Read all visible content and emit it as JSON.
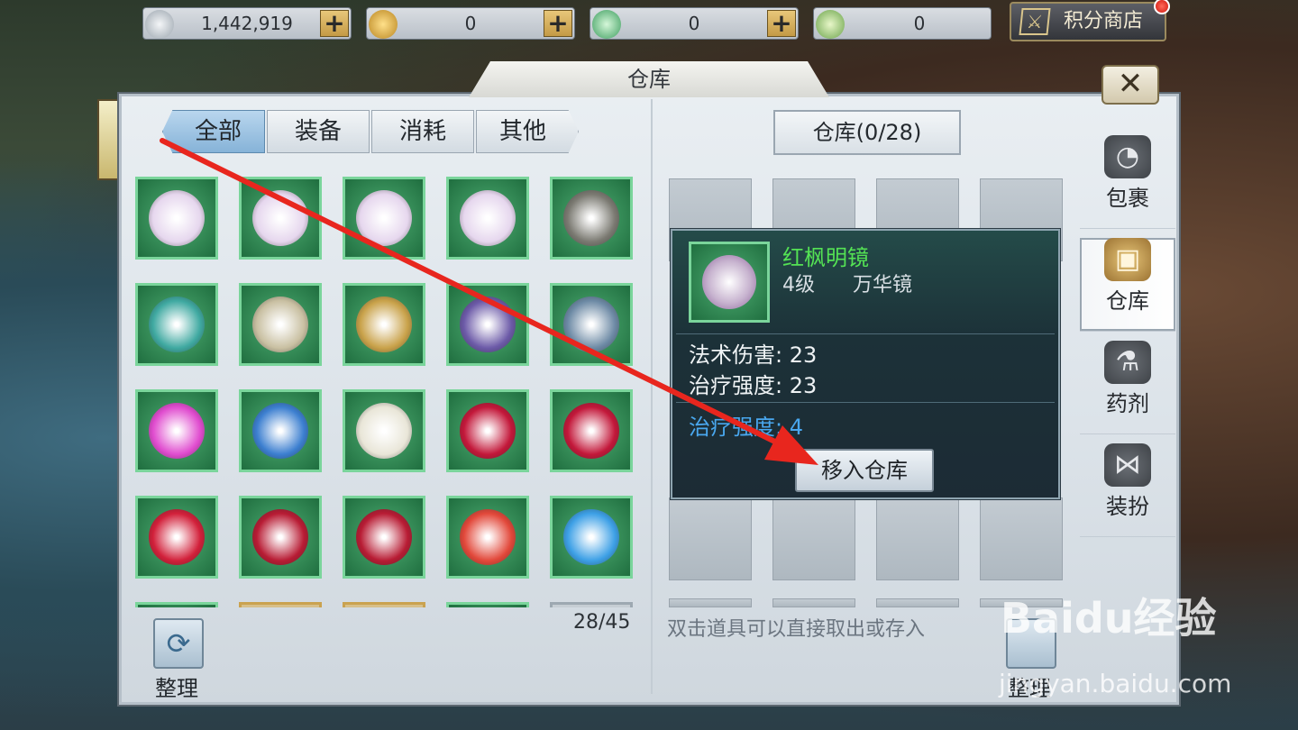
{
  "currencies": [
    {
      "name": "silver-coin-icon",
      "value": "1,442,919",
      "color": "#cfd6dd"
    },
    {
      "name": "gold-coin-icon",
      "value": "0",
      "color": "#e0b64a"
    },
    {
      "name": "ingot-icon",
      "value": "0",
      "color": "#6fd08a"
    },
    {
      "name": "locked-ingot-icon",
      "value": "0",
      "color": "#9ad07a"
    }
  ],
  "plus_label": "+",
  "shop": {
    "label": "积分商店"
  },
  "panel": {
    "title": "仓库",
    "close_label": "✕"
  },
  "tabs": [
    {
      "label": "全部",
      "active": true
    },
    {
      "label": "装备",
      "active": false
    },
    {
      "label": "消耗",
      "active": false
    },
    {
      "label": "其他",
      "active": false
    }
  ],
  "warehouse": {
    "title": "仓库(0/28)",
    "hint": "双击道具可以直接取出或存入",
    "sort_label": "整理"
  },
  "inventory": {
    "count": "28/45",
    "sort_label": "整理",
    "items": [
      {
        "icon": "mirror-icon",
        "color": "#e6d7ee"
      },
      {
        "icon": "mirror-icon",
        "color": "#e6d7ee"
      },
      {
        "icon": "mirror-icon",
        "color": "#e6d7ee"
      },
      {
        "icon": "mirror-icon",
        "color": "#e6d7ee"
      },
      {
        "icon": "chest-armor-icon",
        "color": "#7b7a72"
      },
      {
        "icon": "robe-icon",
        "color": "#3fa9a1"
      },
      {
        "icon": "helmet-icon",
        "color": "#c9c0a2"
      },
      {
        "icon": "leggings-icon",
        "color": "#c9a24a"
      },
      {
        "icon": "boots-icon",
        "color": "#6c5aa8"
      },
      {
        "icon": "bracer-icon",
        "color": "#6d8aa5"
      },
      {
        "icon": "ring-icon",
        "color": "#e04ccf"
      },
      {
        "icon": "ring-icon",
        "color": "#3c7fd0"
      },
      {
        "icon": "pearl-earring-icon",
        "color": "#e9e6d8"
      },
      {
        "icon": "ruby-earring-icon",
        "color": "#c3183a"
      },
      {
        "icon": "ruby-earring-icon",
        "color": "#c3183a"
      },
      {
        "icon": "ruby-necklace-icon",
        "color": "#d2203a"
      },
      {
        "icon": "ruby-pendant-icon",
        "color": "#b81c34"
      },
      {
        "icon": "ruby-pendant-icon",
        "color": "#b81c34"
      },
      {
        "icon": "red-gem-icon",
        "color": "#e2483a"
      },
      {
        "icon": "blue-gem-icon",
        "color": "#3da0e6"
      }
    ]
  },
  "tooltip": {
    "name": "红枫明镜",
    "level": "4级",
    "type": "万华镜",
    "stats": [
      "法术伤害: 23",
      "治疗强度: 23"
    ],
    "bonus": "治疗强度: 4",
    "move_label": "移入仓库"
  },
  "sidenav": [
    {
      "label": "包裹",
      "icon": "bag-icon",
      "active": false
    },
    {
      "label": "仓库",
      "icon": "warehouse-chest-icon",
      "active": true
    },
    {
      "label": "药剂",
      "icon": "potion-icon",
      "active": false
    },
    {
      "label": "装扮",
      "icon": "bow-icon",
      "active": false
    }
  ],
  "watermark": {
    "logo": "Baidu经验",
    "url": "jingyan.baidu.com"
  }
}
